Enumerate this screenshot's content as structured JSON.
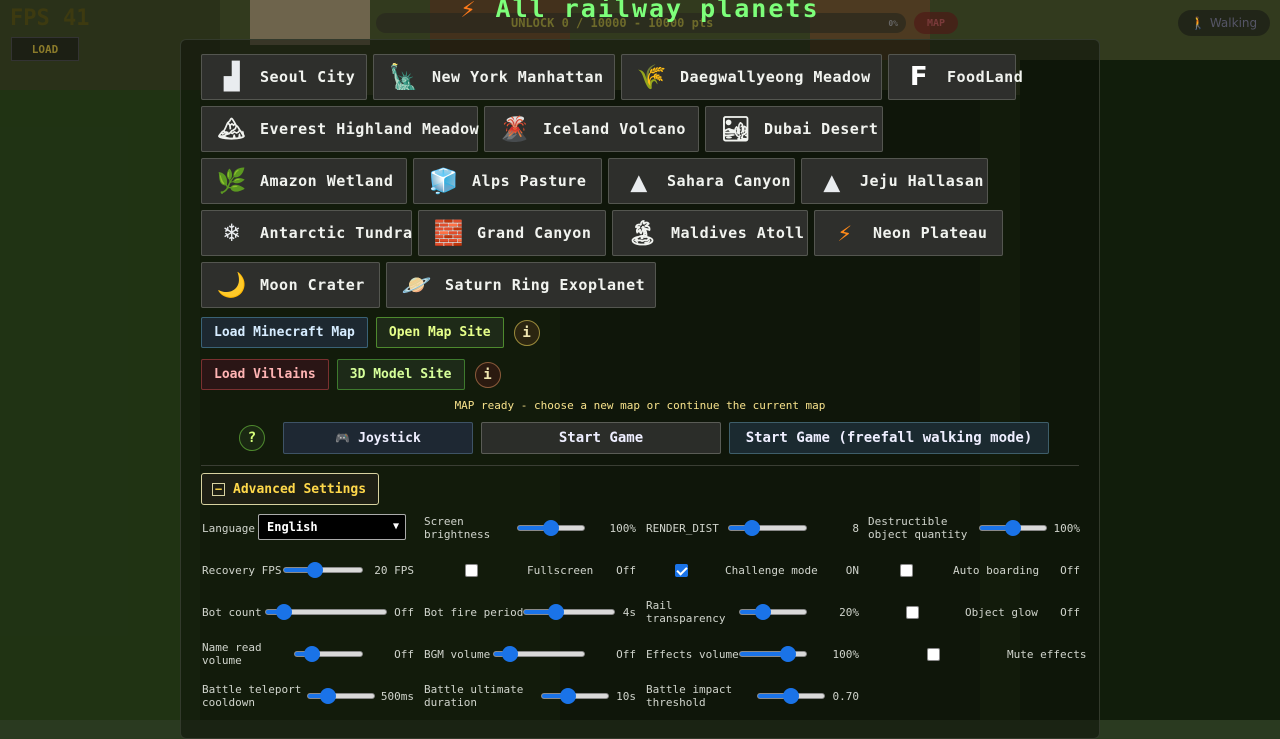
{
  "hud": {
    "fps": "FPS 41",
    "load_label": "LOAD",
    "unlock_text": "UNLOCK 0 / 10000 - 10000 pts",
    "unlock_pct": "0%",
    "map_label": "MAP",
    "walking_label": "Walking"
  },
  "title": {
    "icon": "lightning-bolt-icon",
    "text": "All railway planets"
  },
  "planets": [
    [
      {
        "label": "Seoul City",
        "icon": "city-buildings-icon",
        "glyph": "▟"
      },
      {
        "label": "New York Manhattan",
        "icon": "statue-of-liberty-icon",
        "glyph": "🗽"
      },
      {
        "label": "Daegwallyeong Meadow",
        "icon": "wheat-icon",
        "glyph": "🌾"
      },
      {
        "label": "FoodLand",
        "icon": "letter-f-icon",
        "glyph": "F"
      }
    ],
    [
      {
        "label": "Everest Highland Meadow",
        "icon": "snow-mountain-icon",
        "glyph": "🏔"
      },
      {
        "label": "Iceland Volcano",
        "icon": "volcano-icon",
        "glyph": "🌋"
      },
      {
        "label": "Dubai Desert",
        "icon": "desert-buildings-icon",
        "glyph": "🏜"
      }
    ],
    [
      {
        "label": "Amazon Wetland",
        "icon": "leaf-icon",
        "glyph": "🌿"
      },
      {
        "label": "Alps Pasture",
        "icon": "ice-cube-icon",
        "glyph": "🧊"
      },
      {
        "label": "Sahara Canyon",
        "icon": "triangle-mountain-icon",
        "glyph": "▲"
      },
      {
        "label": "Jeju Hallasan",
        "icon": "triangle-mountain-icon",
        "glyph": "▲"
      }
    ],
    [
      {
        "label": "Antarctic Tundra",
        "icon": "snowflake-icon",
        "glyph": "❄"
      },
      {
        "label": "Grand Canyon",
        "icon": "brick-wall-icon",
        "glyph": "🧱"
      },
      {
        "label": "Maldives Atoll",
        "icon": "island-icon",
        "glyph": "🏝"
      },
      {
        "label": "Neon Plateau",
        "icon": "lightning-bolt-icon",
        "glyph": "⚡"
      }
    ],
    [
      {
        "label": "Moon Crater",
        "icon": "crescent-moon-icon",
        "glyph": "🌙"
      },
      {
        "label": "Saturn Ring Exoplanet",
        "icon": "ringed-planet-icon",
        "glyph": "🪐"
      }
    ]
  ],
  "links": {
    "load_minecraft": "Load Minecraft Map",
    "open_map_site": "Open Map Site",
    "load_villains": "Load Villains",
    "model_site": "3D Model Site",
    "info": "i"
  },
  "status": "MAP ready - choose a new map or continue the current map",
  "start": {
    "help": "?",
    "joystick": "Joystick",
    "start_game": "Start Game",
    "start_freefall": "Start Game (freefall walking mode)"
  },
  "advanced": {
    "toggle": "−",
    "label": "Advanced Settings"
  },
  "settings": {
    "language": {
      "label": "Language",
      "value": "English"
    },
    "screen_brightness": {
      "label": "Screen brightness",
      "value": "100%",
      "level": 0.5
    },
    "render_dist": {
      "label": "RENDER_DIST",
      "value": "8",
      "level": 0.3
    },
    "destructible": {
      "label": "Destructible object quantity",
      "value": "100%",
      "level": 0.5
    },
    "recovery_fps": {
      "label": "Recovery FPS",
      "value": "20 FPS",
      "level": 0.4
    },
    "fullscreen": {
      "label": "Fullscreen",
      "value": "Off",
      "checked": false
    },
    "challenge": {
      "label": "Challenge mode",
      "value": "ON",
      "checked": true
    },
    "auto_boarding": {
      "label": "Auto boarding",
      "value": "Off",
      "checked": false
    },
    "bot_count": {
      "label": "Bot count",
      "value": "Off",
      "level": 0.15
    },
    "bot_fire": {
      "label": "Bot fire period",
      "value": "4s",
      "level": 0.35
    },
    "rail_transparency": {
      "label": "Rail transparency",
      "value": "20%",
      "level": 0.35
    },
    "object_glow": {
      "label": "Object glow",
      "value": "Off",
      "checked": false
    },
    "name_read": {
      "label": "Name read volume",
      "value": "Off",
      "level": 0.25
    },
    "bgm_volume": {
      "label": "BGM volume",
      "value": "Off",
      "level": 0.18
    },
    "effects_volume": {
      "label": "Effects volume",
      "value": "100%",
      "level": 0.72
    },
    "mute_effects": {
      "label": "Mute effects",
      "checked": false
    },
    "teleport_cd": {
      "label": "Battle teleport cooldown",
      "value": "500ms",
      "level": 0.3
    },
    "ultimate_duration": {
      "label": "Battle ultimate duration",
      "value": "10s",
      "level": 0.4
    },
    "impact_threshold": {
      "label": "Battle impact threshold",
      "value": "0.70",
      "level": 0.5
    }
  }
}
